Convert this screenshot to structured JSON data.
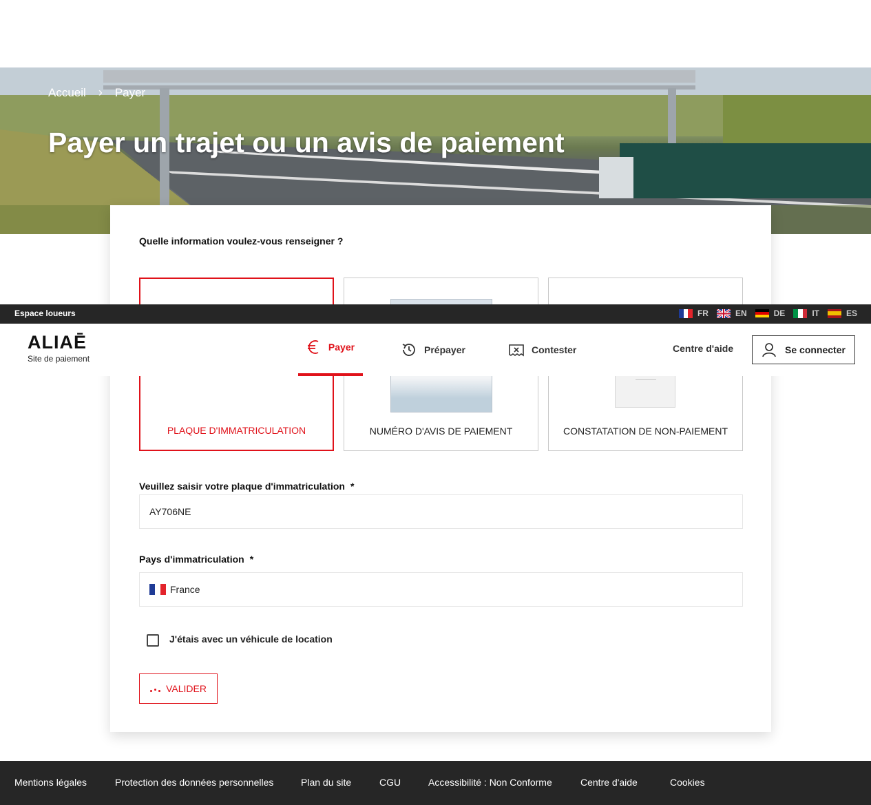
{
  "breadcrumb": {
    "home": "Accueil",
    "separator": "›",
    "current": "Payer"
  },
  "hero": {
    "title": "Payer un trajet ou un avis de paiement"
  },
  "form": {
    "question": "Quelle information voulez-vous renseigner ?",
    "options": [
      {
        "label": "PLAQUE D'IMMATRICULATION",
        "selected": true
      },
      {
        "label": "NUMÉRO D'AVIS DE PAIEMENT",
        "selected": false
      },
      {
        "label": "CONSTATATION DE NON-PAIEMENT",
        "selected": false
      }
    ],
    "plate_label": "Veuillez saisir votre plaque d'immatriculation",
    "required_mark": "*",
    "plate_value": "AY706NE",
    "country_label": "Pays d'immatriculation",
    "country_value": "France",
    "rental_label": "J'étais avec un véhicule de location",
    "rental_checked": false,
    "submit_label": "VALIDER"
  },
  "topbar": {
    "espace": "Espace loueurs",
    "languages": [
      "FR",
      "EN",
      "DE",
      "IT",
      "ES"
    ]
  },
  "header": {
    "logo": "ALIAĒ",
    "logo_sub": "Site de paiement",
    "nav": [
      {
        "label": "Payer",
        "icon": "euro-icon",
        "active": true
      },
      {
        "label": "Prépayer",
        "icon": "clock-refresh-icon",
        "active": false
      },
      {
        "label": "Contester",
        "icon": "ticket-x-icon",
        "active": false
      }
    ],
    "help": "Centre d'aide",
    "login": "Se connecter"
  },
  "footer": {
    "links": [
      "Mentions légales",
      "Protection des données personnelles",
      "Plan du site",
      "CGU",
      "Accessibilité : Non Conforme",
      "Centre d'aide",
      "Cookies"
    ]
  },
  "colors": {
    "accent": "#e0121a",
    "dark": "#262626"
  }
}
